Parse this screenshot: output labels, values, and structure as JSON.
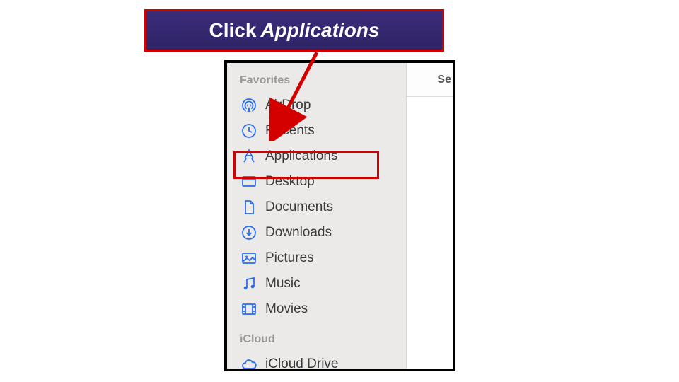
{
  "callout": {
    "prefix": "Click",
    "target": "Applications"
  },
  "sidebar": {
    "sections": [
      {
        "header": "Favorites",
        "items": [
          {
            "icon": "airdrop-icon",
            "label": "AirDrop"
          },
          {
            "icon": "recents-icon",
            "label": "Recents"
          },
          {
            "icon": "applications-icon",
            "label": "Applications"
          },
          {
            "icon": "desktop-icon",
            "label": "Desktop"
          },
          {
            "icon": "documents-icon",
            "label": "Documents"
          },
          {
            "icon": "downloads-icon",
            "label": "Downloads"
          },
          {
            "icon": "pictures-icon",
            "label": "Pictures"
          },
          {
            "icon": "music-icon",
            "label": "Music"
          },
          {
            "icon": "movies-icon",
            "label": "Movies"
          }
        ]
      },
      {
        "header": "iCloud",
        "items": [
          {
            "icon": "icloud-icon",
            "label": "iCloud Drive"
          }
        ]
      }
    ]
  },
  "toolbar": {
    "search_label": "Se"
  },
  "colors": {
    "accent": "#2a6ef0",
    "highlight": "#d40000"
  }
}
